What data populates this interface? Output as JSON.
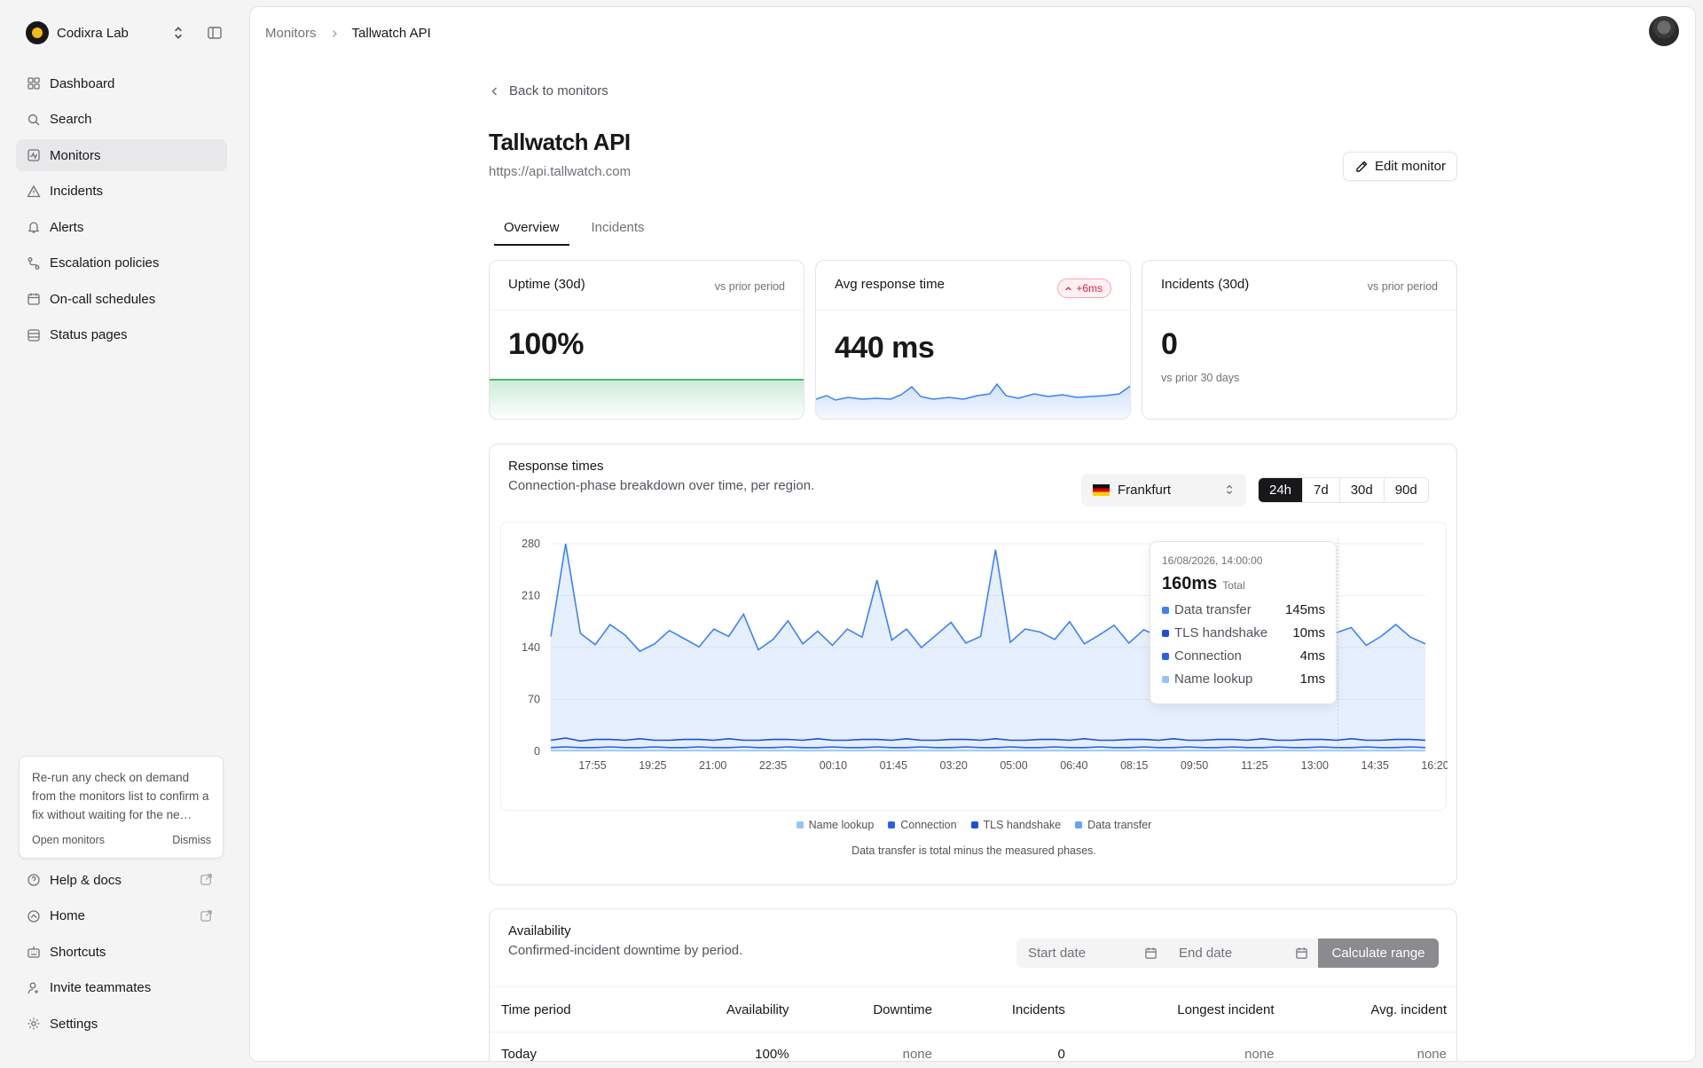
{
  "org": {
    "name": "Codixra Lab"
  },
  "sidebar": {
    "items": [
      {
        "label": "Dashboard",
        "icon": "grid-icon"
      },
      {
        "label": "Search",
        "icon": "search-icon"
      },
      {
        "label": "Monitors",
        "icon": "activity-icon",
        "active": true
      },
      {
        "label": "Incidents",
        "icon": "warning-triangle-icon"
      },
      {
        "label": "Alerts",
        "icon": "bell-icon"
      },
      {
        "label": "Escalation policies",
        "icon": "escalation-icon"
      },
      {
        "label": "On-call schedules",
        "icon": "calendar-icon"
      },
      {
        "label": "Status pages",
        "icon": "status-page-icon"
      }
    ],
    "tip": {
      "text": "Re-run any check on demand from the monitors list to confirm a fix without waiting for the ne…",
      "primary": "Open monitors",
      "secondary": "Dismiss"
    },
    "footer": [
      {
        "label": "Help & docs",
        "icon": "help-circle-icon",
        "external": true
      },
      {
        "label": "Home",
        "icon": "home-icon",
        "external": true
      },
      {
        "label": "Shortcuts",
        "icon": "keyboard-icon"
      },
      {
        "label": "Invite teammates",
        "icon": "user-plus-icon"
      },
      {
        "label": "Settings",
        "icon": "gear-icon"
      }
    ]
  },
  "breadcrumb": [
    "Monitors",
    "Tallwatch API"
  ],
  "page": {
    "back": "Back to monitors",
    "title": "Tallwatch API",
    "url": "https://api.tallwatch.com",
    "edit": "Edit monitor",
    "tabs": [
      "Overview",
      "Incidents"
    ]
  },
  "cards": {
    "uptime": {
      "title": "Uptime (30d)",
      "note": "vs prior period",
      "value": "100%"
    },
    "response": {
      "title": "Avg response time",
      "badge": "+6ms",
      "value": "440 ms"
    },
    "incidents": {
      "title": "Incidents (30d)",
      "note": "vs prior period",
      "value": "0",
      "sub": "vs prior 30 days"
    }
  },
  "response_times": {
    "title": "Response times",
    "subtitle": "Connection-phase breakdown over time, per region.",
    "region": "Frankfurt",
    "ranges": [
      "24h",
      "7d",
      "30d",
      "90d"
    ],
    "active_range": "24h",
    "tooltip": {
      "time": "16/08/2026, 14:00:00",
      "total": "160ms",
      "total_label": "Total",
      "rows": [
        {
          "label": "Data transfer",
          "value": "145ms",
          "color": "#3b82f6"
        },
        {
          "label": "TLS handshake",
          "value": "10ms",
          "color": "#1d4ed8"
        },
        {
          "label": "Connection",
          "value": "4ms",
          "color": "#2563eb"
        },
        {
          "label": "Name lookup",
          "value": "1ms",
          "color": "#93c5fd"
        }
      ]
    },
    "legend": [
      {
        "label": "Name lookup",
        "color": "#93c5fd"
      },
      {
        "label": "Connection",
        "color": "#2563eb"
      },
      {
        "label": "TLS handshake",
        "color": "#1d4ed8"
      },
      {
        "label": "Data transfer",
        "color": "#60a5fa"
      }
    ],
    "note": "Data transfer is total minus the measured phases."
  },
  "chart_data": {
    "type": "area",
    "x": [
      "17:55",
      "19:25",
      "21:00",
      "22:35",
      "00:10",
      "01:45",
      "03:20",
      "05:00",
      "06:40",
      "08:15",
      "09:50",
      "11:25",
      "13:00",
      "14:35",
      "16:20"
    ],
    "yticks": [
      0,
      70,
      140,
      210,
      280
    ],
    "ylim": [
      0,
      280
    ],
    "grid": true,
    "legend_position": "bottom",
    "series": [
      {
        "name": "Data transfer",
        "values": [
          140,
          262,
          145,
          128,
          155,
          142,
          118,
          130,
          148,
          136,
          125,
          150,
          138,
          170,
          122,
          135,
          160,
          130,
          145,
          128,
          150,
          138,
          215,
          135,
          148,
          125,
          142,
          158,
          130,
          140,
          255,
          132,
          150,
          145,
          135,
          160,
          128,
          142,
          155,
          130,
          148,
          140,
          136,
          168,
          125,
          150,
          138,
          145,
          232,
          130,
          142,
          160,
          135,
          145,
          150,
          128,
          140,
          155,
          138,
          130
        ]
      },
      {
        "name": "TLS handshake",
        "values": [
          10,
          12,
          9,
          11,
          10,
          10,
          12,
          9,
          10,
          11,
          10,
          10,
          12,
          9,
          10,
          11,
          10,
          10,
          12,
          9,
          10,
          11,
          10,
          10,
          12,
          9,
          10,
          11,
          10,
          10,
          12,
          9,
          10,
          11,
          10,
          10,
          12,
          9,
          10,
          11,
          10,
          10,
          12,
          9,
          10,
          11,
          10,
          10,
          12,
          9,
          10,
          11,
          10,
          10,
          12,
          9,
          10,
          11,
          10,
          10
        ]
      },
      {
        "name": "Connection",
        "values": [
          4,
          5,
          4,
          4,
          5,
          4,
          4,
          5,
          4,
          4,
          5,
          4,
          4,
          5,
          4,
          4,
          5,
          4,
          4,
          5,
          4,
          4,
          5,
          4,
          4,
          5,
          4,
          4,
          5,
          4,
          4,
          5,
          4,
          4,
          5,
          4,
          4,
          5,
          4,
          4,
          5,
          4,
          4,
          5,
          4,
          4,
          5,
          4,
          4,
          5,
          4,
          4,
          5,
          4,
          4,
          5,
          4,
          4,
          5,
          4
        ]
      },
      {
        "name": "Name lookup",
        "values": [
          1,
          1,
          1,
          1,
          1,
          1,
          1,
          1,
          1,
          1,
          1,
          1,
          1,
          1,
          1,
          1,
          1,
          1,
          1,
          1,
          1,
          1,
          1,
          1,
          1,
          1,
          1,
          1,
          1,
          1,
          1,
          1,
          1,
          1,
          1,
          1,
          1,
          1,
          1,
          1,
          1,
          1,
          1,
          1,
          1,
          1,
          1,
          1,
          1,
          1,
          1,
          1,
          1,
          1,
          1,
          1,
          1,
          1,
          1,
          1
        ]
      }
    ]
  },
  "availability": {
    "title": "Availability",
    "subtitle": "Confirmed-incident downtime by period.",
    "start_placeholder": "Start date",
    "end_placeholder": "End date",
    "calculate": "Calculate range",
    "columns": [
      "Time period",
      "Availability",
      "Downtime",
      "Incidents",
      "Longest incident",
      "Avg. incident"
    ],
    "rows": [
      [
        "Today",
        "100%",
        "none",
        "0",
        "none",
        "none"
      ]
    ]
  }
}
